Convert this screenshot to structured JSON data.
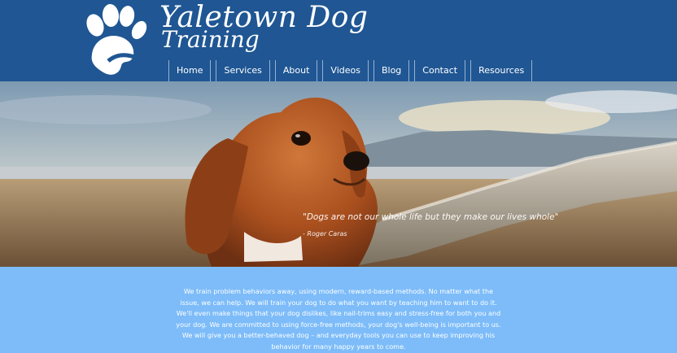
{
  "brand": {
    "line1": "Yaletown Dog",
    "line2": "Training",
    "logo_icon": "paw-print-icon"
  },
  "nav": {
    "items": [
      {
        "label": "Home"
      },
      {
        "label": "Services"
      },
      {
        "label": "About"
      },
      {
        "label": "Videos"
      },
      {
        "label": "Blog"
      },
      {
        "label": "Contact"
      },
      {
        "label": "Resources"
      }
    ]
  },
  "hero": {
    "image": "cavalier-spaniel-puppy-photo",
    "quote": "\"Dogs are not our whole life but they make our lives whole\"",
    "author": "- Roger Caras"
  },
  "intro": {
    "text": "We train problem behaviors away, using modern, reward-based methods. No matter what the issue, we can help. We will train your dog to do what you want by teaching him to want to do it. We'll even make things that your dog dislikes, like nail-trims easy and stress-free for both you and your dog. We are committed to using force-free methods, your dog's well-being is important to us. We will give you a better-behaved dog – and everyday tools you can use to keep improving his behavior for many happy years to come."
  },
  "colors": {
    "header_bg": "#1f5693",
    "intro_bg": "#7dbcf9",
    "text": "#ffffff"
  }
}
